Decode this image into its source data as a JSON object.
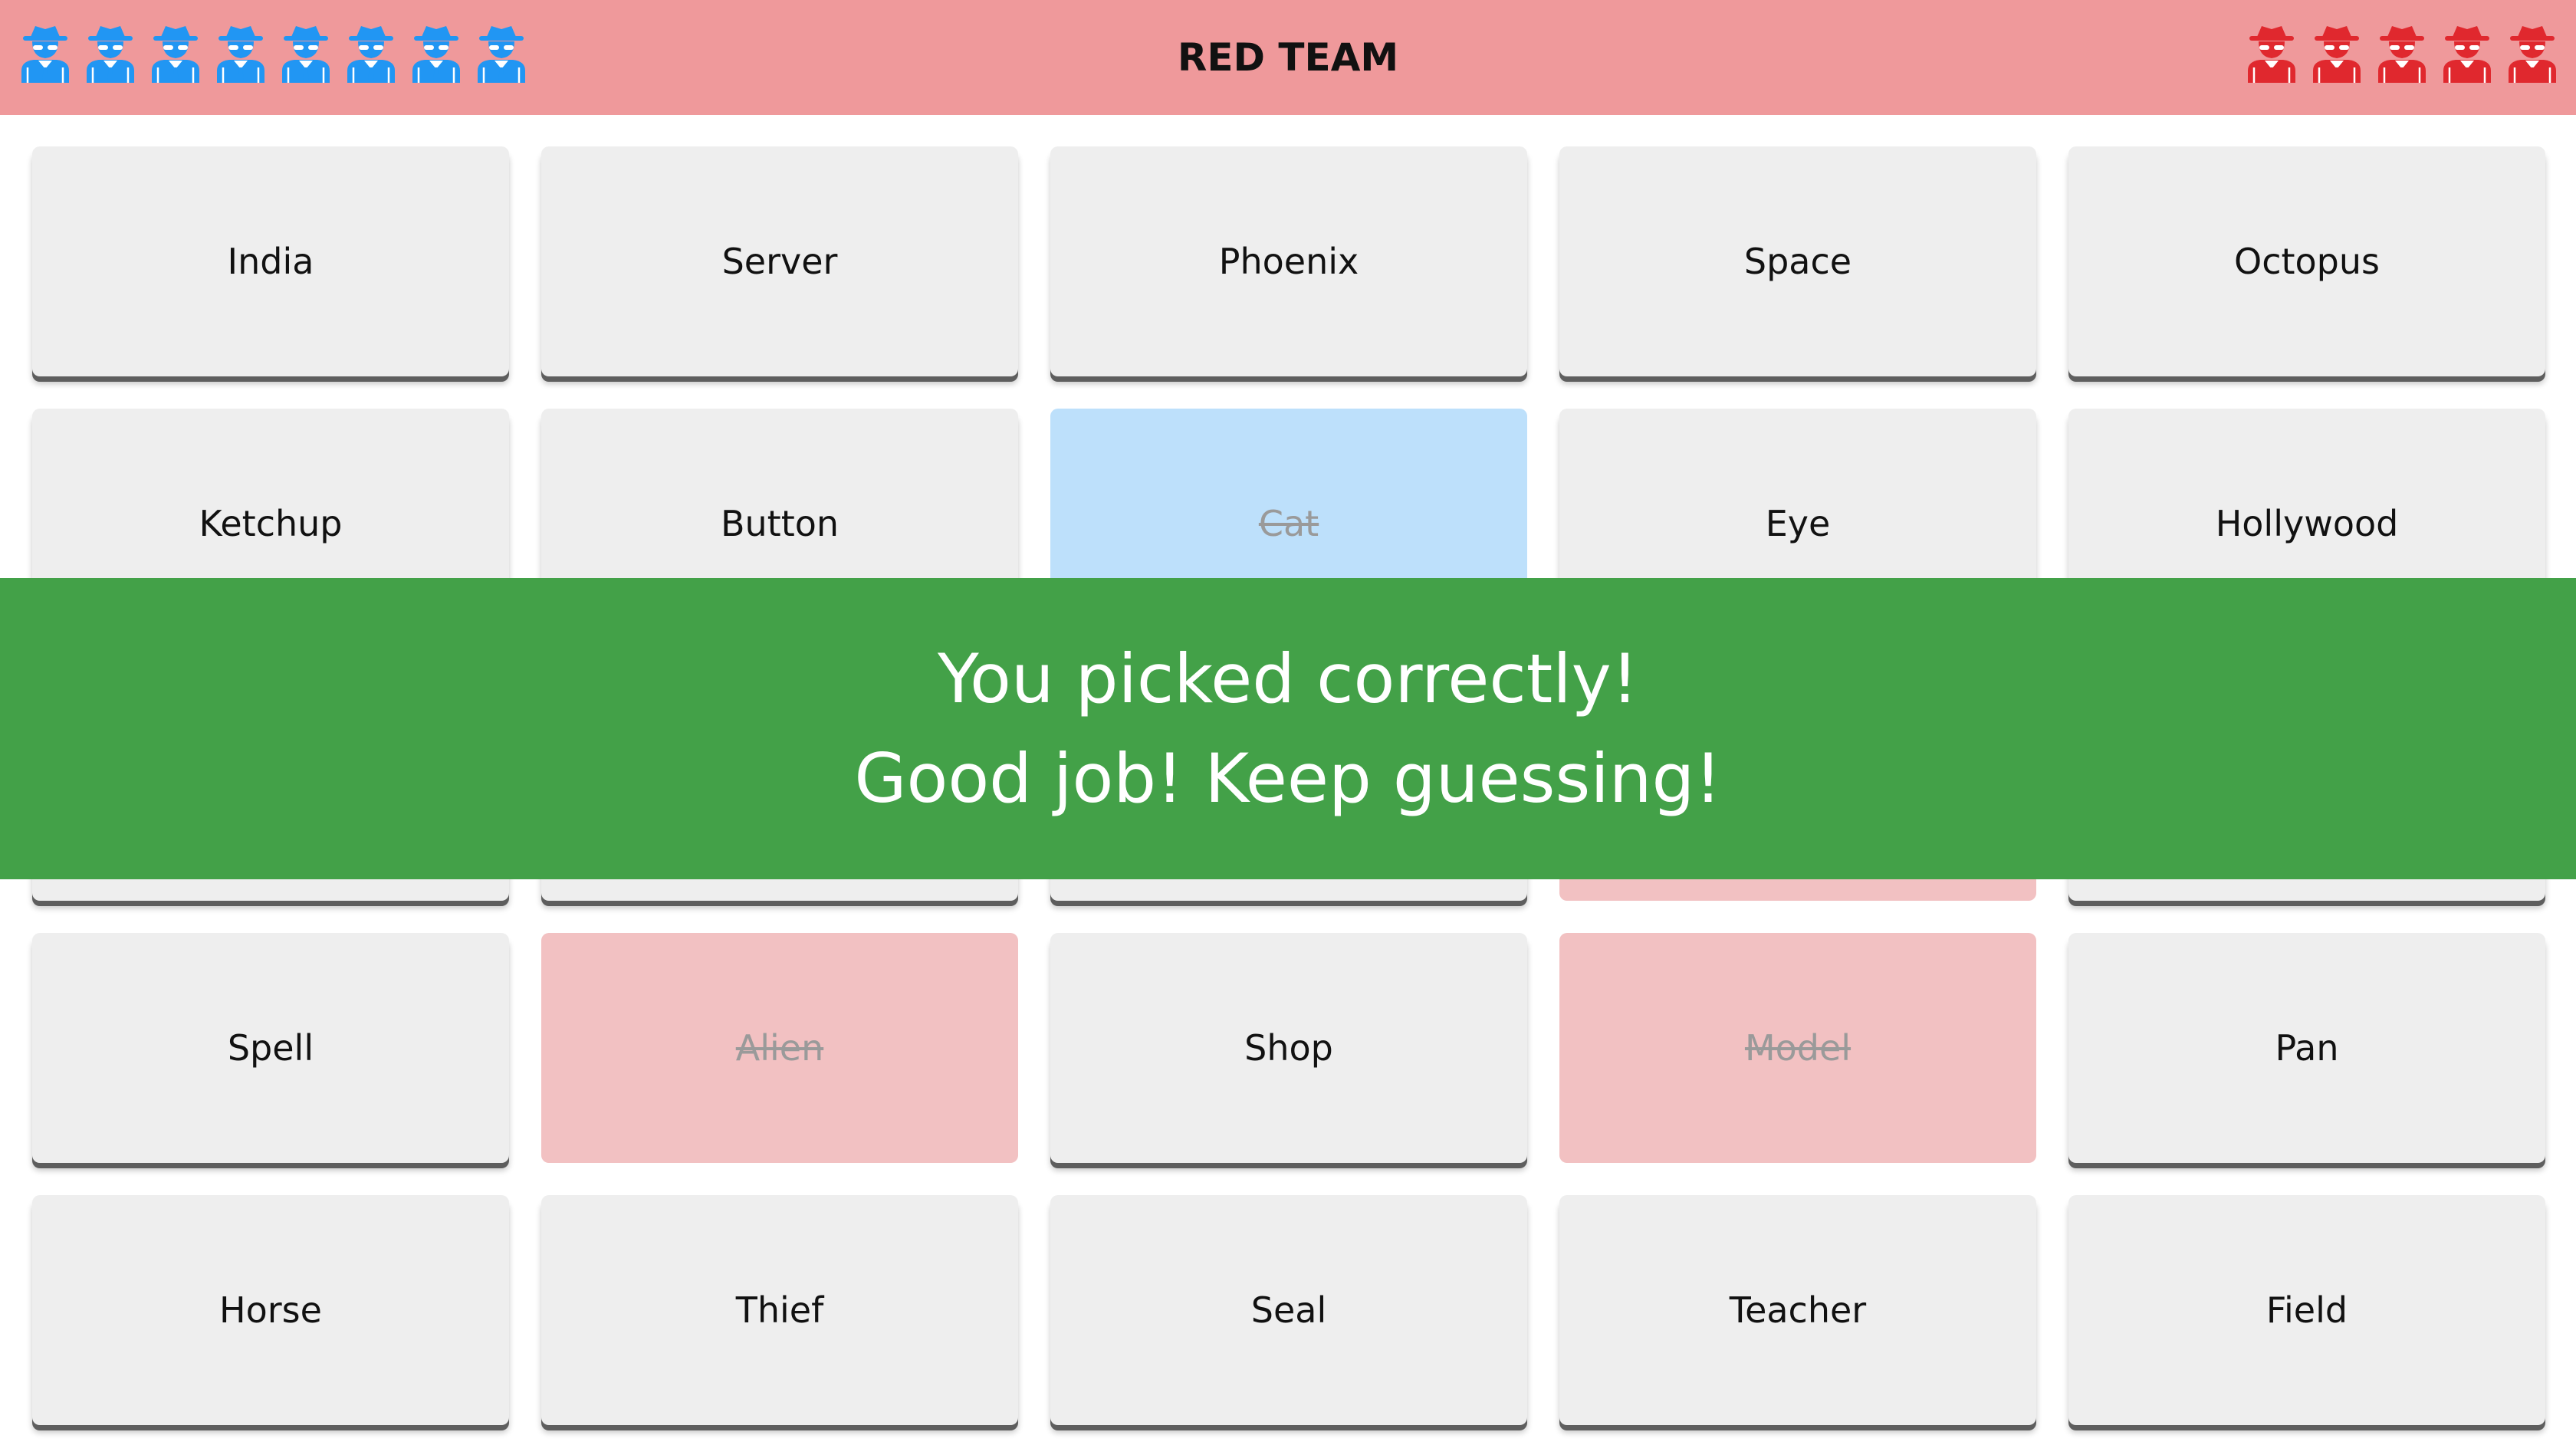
{
  "header": {
    "title": "RED TEAM",
    "blue_agents_remaining": 8,
    "red_agents_remaining": 5,
    "blue_color": "#2196f3",
    "red_color": "#e0282e",
    "agent_icon": "spy-agent-icon"
  },
  "banner": {
    "line1": "You picked correctly!",
    "line2": "Good job! Keep guessing!",
    "color": "#43a148"
  },
  "board": {
    "cards": [
      {
        "word": "India",
        "state": "hidden"
      },
      {
        "word": "Server",
        "state": "hidden"
      },
      {
        "word": "Phoenix",
        "state": "hidden"
      },
      {
        "word": "Space",
        "state": "hidden"
      },
      {
        "word": "Octopus",
        "state": "hidden"
      },
      {
        "word": "Ketchup",
        "state": "hidden"
      },
      {
        "word": "Button",
        "state": "hidden"
      },
      {
        "word": "Cat",
        "state": "revealed-blue"
      },
      {
        "word": "Eye",
        "state": "hidden"
      },
      {
        "word": "Hollywood",
        "state": "hidden"
      },
      {
        "word": "",
        "state": "hidden"
      },
      {
        "word": "",
        "state": "hidden"
      },
      {
        "word": "",
        "state": "hidden"
      },
      {
        "word": "",
        "state": "revealed-red"
      },
      {
        "word": "",
        "state": "hidden"
      },
      {
        "word": "Spell",
        "state": "hidden"
      },
      {
        "word": "Alien",
        "state": "revealed-red"
      },
      {
        "word": "Shop",
        "state": "hidden"
      },
      {
        "word": "Model",
        "state": "revealed-red"
      },
      {
        "word": "Pan",
        "state": "hidden"
      },
      {
        "word": "Horse",
        "state": "hidden"
      },
      {
        "word": "Thief",
        "state": "hidden"
      },
      {
        "word": "Seal",
        "state": "hidden"
      },
      {
        "word": "Teacher",
        "state": "hidden"
      },
      {
        "word": "Field",
        "state": "hidden"
      }
    ]
  }
}
